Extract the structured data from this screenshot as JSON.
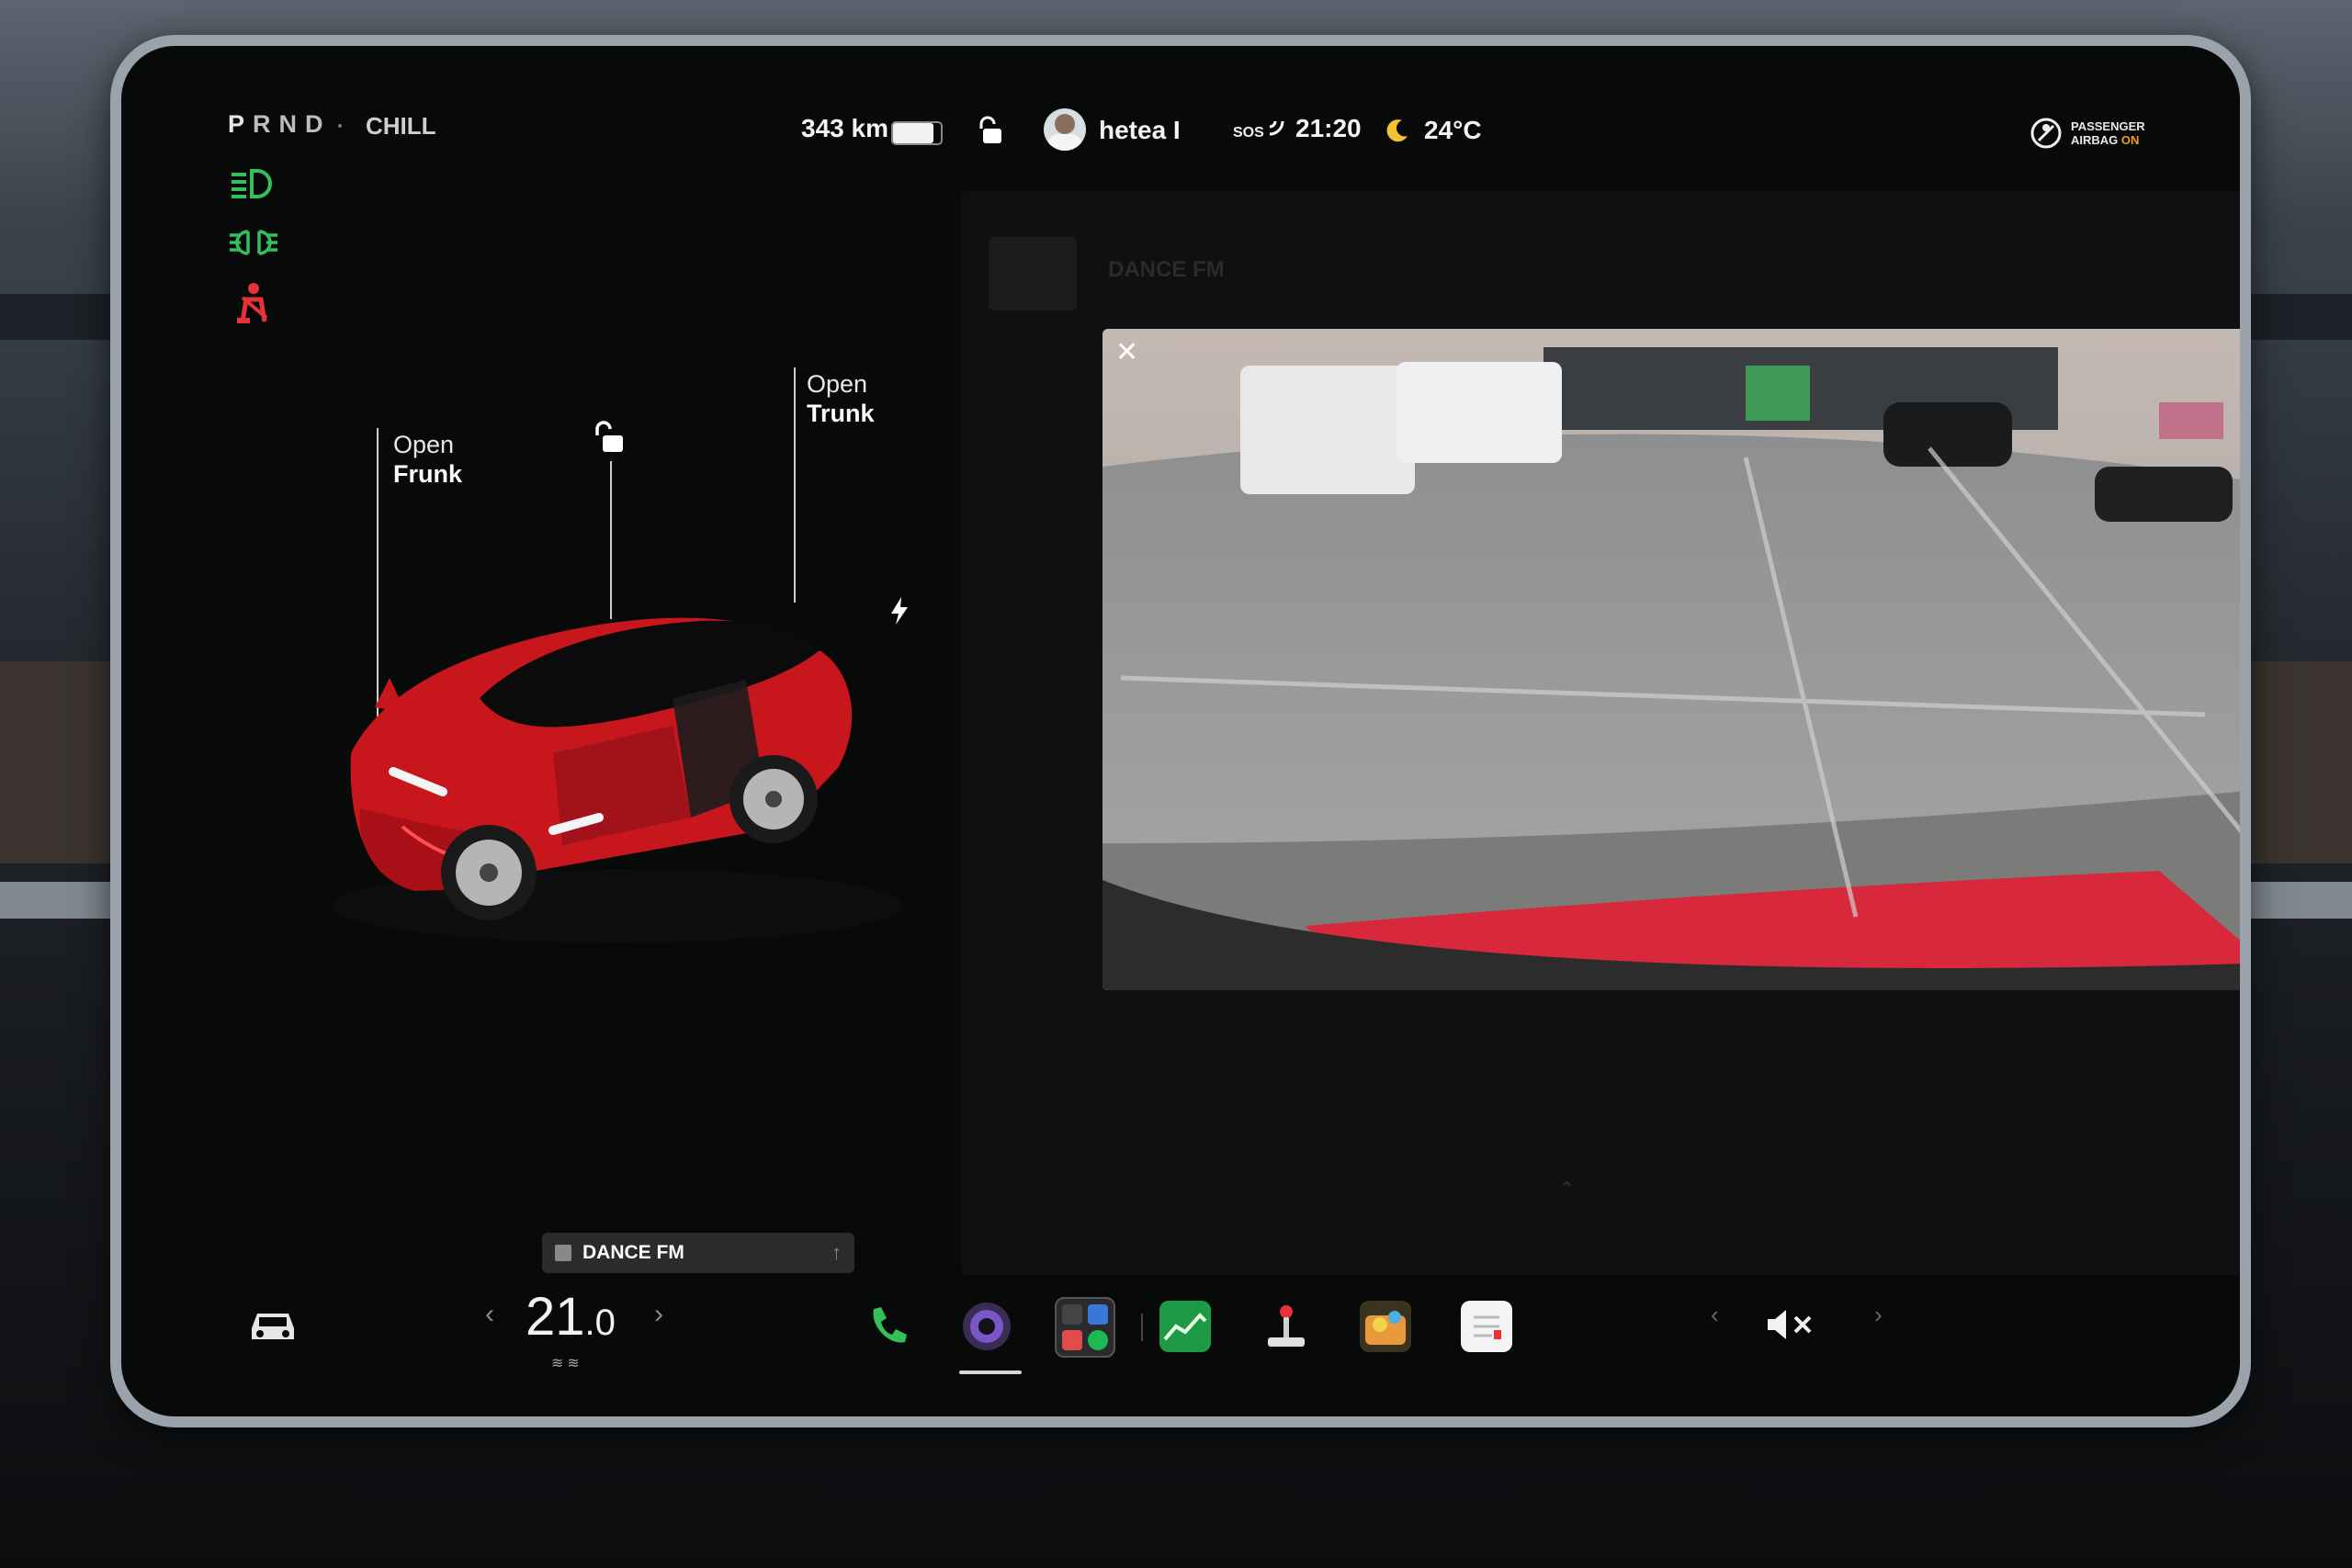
{
  "status_bar": {
    "gears": [
      "P",
      "R",
      "N",
      "D"
    ],
    "drive_mode": "CHILL",
    "range": "343 km",
    "battery_level": 0.85,
    "profile_name": "hetea I",
    "sos_label": "SOS",
    "time": "21:20",
    "temperature": "24°C",
    "airbag_line1": "PASSENGER",
    "airbag_line2": "AIRBAG",
    "airbag_state": "ON"
  },
  "car_panel": {
    "frunk_line1": "Open",
    "frunk_line2": "Frunk",
    "trunk_line1": "Open",
    "trunk_line2": "Trunk"
  },
  "media": {
    "station_mini": "DANCE FM",
    "station_behind": "DANCE FM"
  },
  "camera": {
    "close_label": "✕"
  },
  "bottom_bar": {
    "cabin_temp_whole": "21",
    "cabin_temp_decimal": ".0",
    "left_arrow": "‹",
    "right_arrow": "›",
    "vol_left": "‹",
    "vol_right": "›"
  },
  "colors": {
    "accent_green": "#33c05a",
    "warning_red": "#e8323a",
    "car_red": "#c8161d"
  },
  "icons": [
    "headlights-icon",
    "parking-lights-icon",
    "seatbelt-warning-icon",
    "lock-open-icon",
    "charge-port-icon",
    "car-icon",
    "phone-icon",
    "camera-app-icon",
    "app-launcher-icon",
    "energy-app-icon",
    "toybox-icon",
    "photo-app-icon",
    "notes-app-icon",
    "volume-mute-icon"
  ]
}
